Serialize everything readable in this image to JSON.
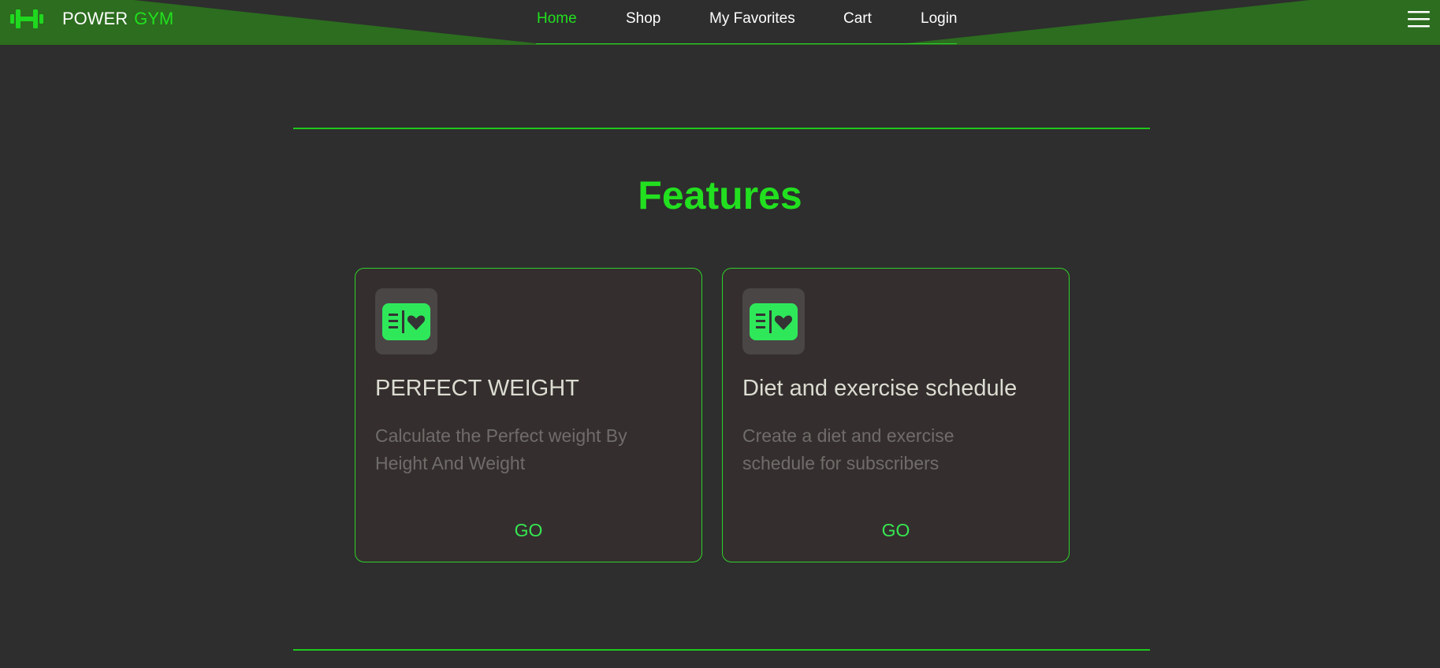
{
  "header": {
    "logo_icon": "dumbbell-icon",
    "brand_first": "POWER",
    "brand_second": "GYM",
    "nav": [
      {
        "label": "Home",
        "active": true
      },
      {
        "label": "Shop",
        "active": false
      },
      {
        "label": "My Favorites",
        "active": false
      },
      {
        "label": "Cart",
        "active": false
      },
      {
        "label": "Login",
        "active": false
      }
    ],
    "menu_icon": "hamburger-menu-icon"
  },
  "features": {
    "title": "Features",
    "cards": [
      {
        "icon": "diet-card-icon",
        "title": "PERFECT WEIGHT",
        "description": "Calculate the Perfect weight By Height And Weight",
        "action": "GO"
      },
      {
        "icon": "diet-card-icon",
        "title": "Diet and exercise schedule",
        "description": "Create a diet and exercise schedule for subscribers",
        "action": "GO"
      }
    ]
  },
  "colors": {
    "accent": "#22e01f",
    "header_bg": "#2c6d1f",
    "page_bg": "#2e2e2e",
    "card_bg": "#342f2e",
    "icon_green": "#2ee85a"
  }
}
